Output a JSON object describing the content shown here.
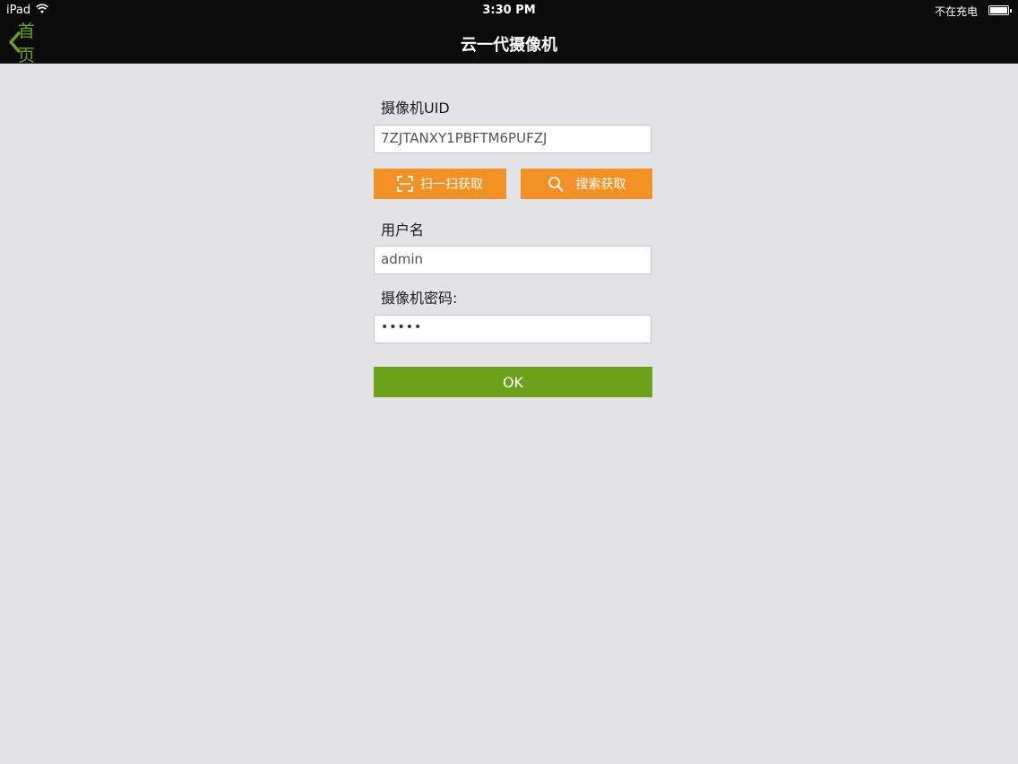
{
  "status_bar": {
    "carrier": "iPad",
    "wifi_icon": "wifi-icon",
    "time": "3:30 PM",
    "charge_status": "不在充电",
    "battery_icon": "battery-icon"
  },
  "nav": {
    "back_label": "首页",
    "back_icon": "chevron-left-icon",
    "title": "云一代摄像机",
    "accent_color": "#6ca21c"
  },
  "form": {
    "uid_label": "摄像机UID",
    "uid_value": "7ZJTANXY1PBFTM6PUFZJ",
    "scan_button": "扫一扫获取",
    "scan_icon": "scan-frame-icon",
    "search_button": "搜索获取",
    "search_icon": "search-icon",
    "username_label": "用户名",
    "username_value": "admin",
    "password_label": "摄像机密码:",
    "password_value": "•••••",
    "ok_button": "OK",
    "button_color_orange": "#f29126",
    "button_color_green": "#6da01a"
  }
}
